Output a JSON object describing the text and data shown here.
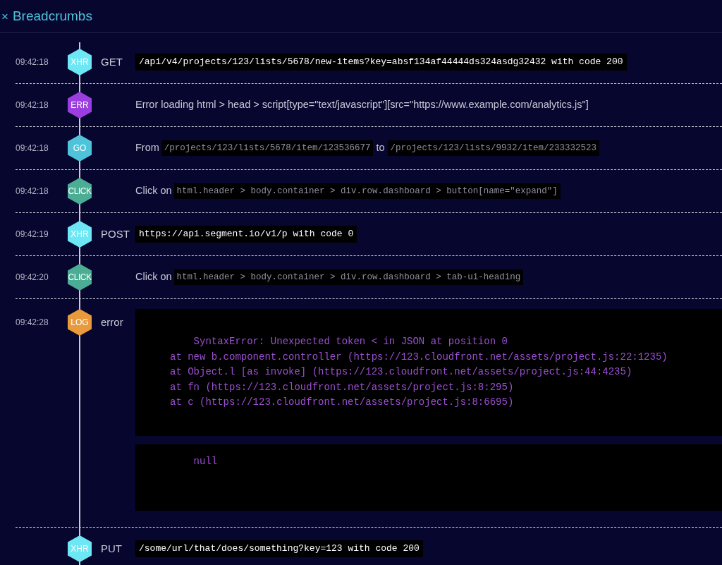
{
  "panel": {
    "close_glyph": "×",
    "title": "Breadcrumbs"
  },
  "events": [
    {
      "kind": "request",
      "time": "09:42:18",
      "badge": "XHR",
      "color": "#6ee7f5",
      "label": "GET",
      "code": "/api/v4/projects/123/lists/5678/new-items?key=absf134af44444ds324asdg32432 with code 200"
    },
    {
      "kind": "error",
      "time": "09:42:18",
      "badge": "ERR",
      "color": "#9b3ee0",
      "message": "Error loading html > head > script[type=\"text/javascript\"][src=\"https://www.example.com/analytics.js\"]"
    },
    {
      "kind": "navigation",
      "time": "09:42:18",
      "badge": "GO",
      "color": "#4fc3d9",
      "from_label": "From",
      "from": "/projects/123/lists/5678/item/123536677",
      "to_label": "to",
      "to": "/projects/123/lists/9932/item/233332523"
    },
    {
      "kind": "click",
      "time": "09:42:18",
      "badge": "CLICK",
      "color": "#4aad94",
      "prefix": "Click on",
      "selector": "html.header > body.container > div.row.dashboard > button[name=\"expand\"]"
    },
    {
      "kind": "request",
      "time": "09:42:19",
      "badge": "XHR",
      "color": "#6ee7f5",
      "label": "POST",
      "code": "https://api.segment.io/v1/p with code 0"
    },
    {
      "kind": "click",
      "time": "09:42:20",
      "badge": "CLICK",
      "color": "#4aad94",
      "prefix": "Click on",
      "selector": "html.header > body.container > div.row.dashboard > tab-ui-heading"
    },
    {
      "kind": "log",
      "time": "09:42:28",
      "badge": "LOG",
      "color": "#e89a3c",
      "label": "error",
      "blocks": [
        "    SyntaxError: Unexpected token < in JSON at position 0\nat new b.component.controller (https://123.cloudfront.net/assets/project.js:22:1235)\nat Object.l [as invoke] (https://123.cloudfront.net/assets/project.js:44:4235)\nat fn (https://123.cloudfront.net/assets/project.js:8:295)\nat c (https://123.cloudfront.net/assets/project.js:8:6695)",
        "    null"
      ]
    },
    {
      "kind": "request",
      "badge": "XHR",
      "color": "#6ee7f5",
      "label": "PUT",
      "code": "/some/url/that/does/something?key=123 with code 200"
    }
  ]
}
